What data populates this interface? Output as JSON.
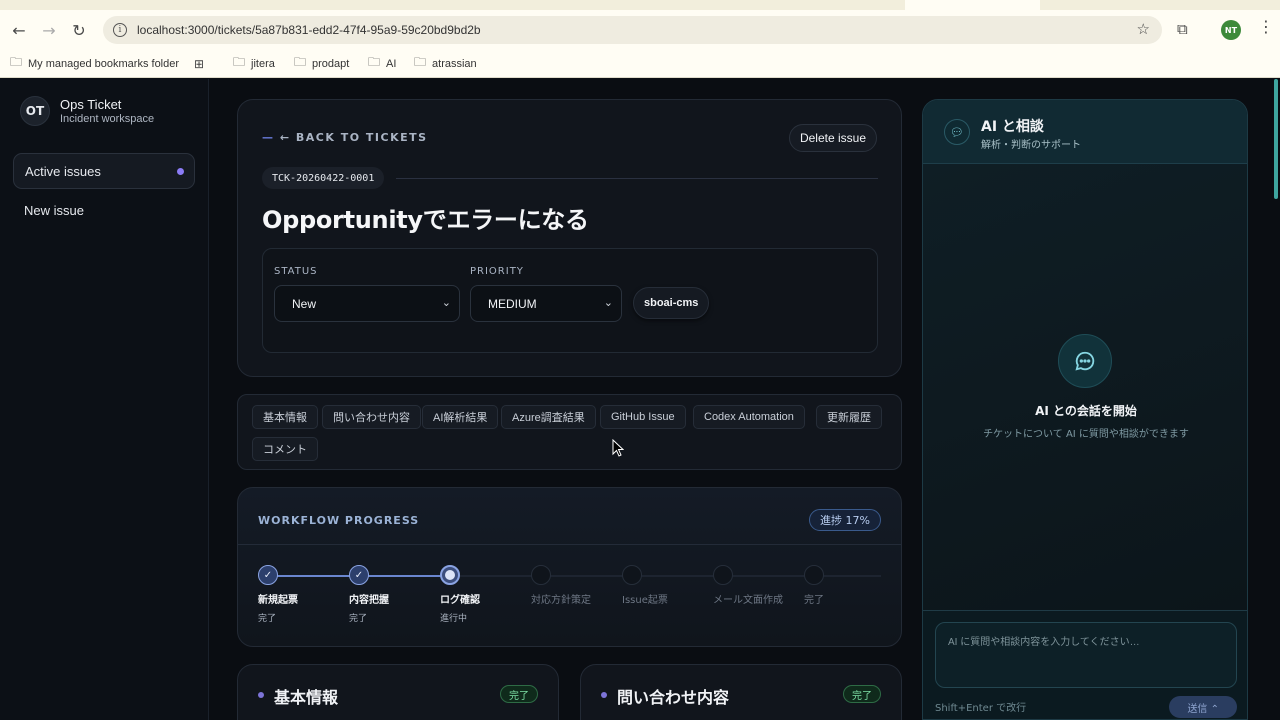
{
  "browser": {
    "url": "localhost:3000/tickets/5a87b831-edd2-47f4-95a9-59c20bd9bd2b",
    "profile_initials": "NT",
    "bookmarks": [
      {
        "label": "My managed bookmarks folder",
        "icon": "managed-folder-icon"
      },
      {
        "label": "",
        "icon": "apps-grid-icon"
      },
      {
        "label": "jitera",
        "icon": "folder-icon"
      },
      {
        "label": "prodapt",
        "icon": "folder-icon"
      },
      {
        "label": "AI",
        "icon": "folder-icon"
      },
      {
        "label": "atrassian",
        "icon": "folder-icon"
      }
    ]
  },
  "sidebar": {
    "logo": "OT",
    "title": "Ops Ticket",
    "subtitle": "Incident workspace",
    "items": [
      {
        "label": "Active issues",
        "active": true
      },
      {
        "label": "New issue",
        "active": false
      }
    ]
  },
  "ticket": {
    "back_label": "← BACK TO TICKETS",
    "back_prefix": "—",
    "delete_label": "Delete issue",
    "id": "TCK-20260422-0001",
    "title": "Opportunityでエラーになる",
    "status_label": "STATUS",
    "status_value": "New",
    "priority_label": "PRIORITY",
    "priority_value": "MEDIUM",
    "tag": "sboai-cms"
  },
  "tabs": [
    "基本情報",
    "問い合わせ内容",
    "AI解析結果",
    "Azure調査結果",
    "GitHub Issue",
    "Codex Automation",
    "更新履歴",
    "コメント"
  ],
  "workflow": {
    "title": "WORKFLOW PROGRESS",
    "progress_label": "進捗 17%",
    "progress": 17,
    "steps": [
      {
        "label": "新規起票",
        "sub": "完了",
        "state": "done"
      },
      {
        "label": "内容把握",
        "sub": "完了",
        "state": "done"
      },
      {
        "label": "ログ確認",
        "sub": "進行中",
        "state": "current"
      },
      {
        "label": "対応方針策定",
        "sub": "",
        "state": "pending"
      },
      {
        "label": "Issue起票",
        "sub": "",
        "state": "pending"
      },
      {
        "label": "メール文面作成",
        "sub": "",
        "state": "pending"
      },
      {
        "label": "完了",
        "sub": "",
        "state": "pending"
      }
    ]
  },
  "sections": [
    {
      "title": "基本情報",
      "badge": "完了"
    },
    {
      "title": "問い合わせ内容",
      "badge": "完了"
    }
  ],
  "ai": {
    "title": "AI と相談",
    "subtitle": "解析・判断のサポート",
    "empty_title": "AI との会話を開始",
    "empty_sub": "チケットについて AI に質問や相談ができます",
    "input_placeholder": "AI に質問や相談内容を入力してください…",
    "hint": "Shift+Enter で改行",
    "send_label": "送信 ⌃"
  },
  "colors": {
    "accent": "#8b7cf6",
    "progress": "#6a86cf",
    "success": "#7fe0a6"
  }
}
